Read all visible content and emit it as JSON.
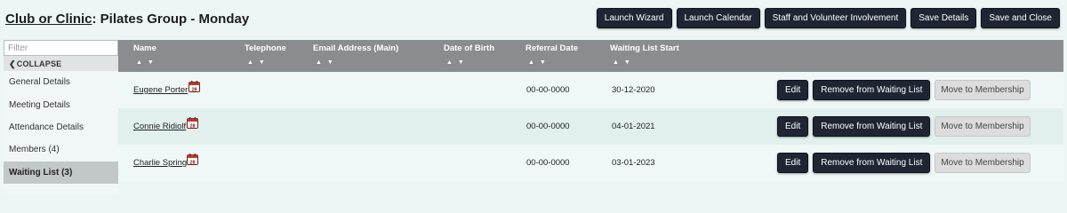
{
  "header": {
    "title_prefix": "Club or Clinic",
    "title_sep": ":",
    "title_main": "Pilates Group - Monday"
  },
  "toolbar": {
    "launch_wizard": "Launch Wizard",
    "launch_calendar": "Launch Calendar",
    "staff_volunteer": "Staff and Volunteer Involvement",
    "save_details": "Save Details",
    "save_close": "Save and Close"
  },
  "sidebar": {
    "filter_placeholder": "Filter",
    "collapse_label": "COLLAPSE",
    "items": [
      {
        "label": "General Details"
      },
      {
        "label": "Meeting Details"
      },
      {
        "label": "Attendance Details"
      },
      {
        "label": "Members (4)"
      },
      {
        "label": "Waiting List (3)"
      }
    ]
  },
  "table": {
    "columns": [
      "Name",
      "Telephone",
      "Email Address (Main)",
      "Date of Birth",
      "Referral Date",
      "Waiting List Start"
    ],
    "sort_glyph": "▲ ▼",
    "calendar_day": "28",
    "rows": [
      {
        "name": "Eugene Porter",
        "telephone": "",
        "email": "",
        "dob": "",
        "referral": "00-00-0000",
        "start": "30-12-2020"
      },
      {
        "name": "Connie Ridiolf",
        "telephone": "",
        "email": "",
        "dob": "",
        "referral": "00-00-0000",
        "start": "04-01-2021"
      },
      {
        "name": "Charlie Spring",
        "telephone": "",
        "email": "",
        "dob": "",
        "referral": "00-00-0000",
        "start": "03-01-2023"
      }
    ],
    "actions": {
      "edit": "Edit",
      "remove": "Remove from Waiting List",
      "move": "Move to Membership"
    }
  },
  "colors": {
    "page_bg": "#eef6f5",
    "header_bar": "#8a8c8f",
    "button_dark": "#1f2533",
    "calendar_red": "#c0392b"
  }
}
